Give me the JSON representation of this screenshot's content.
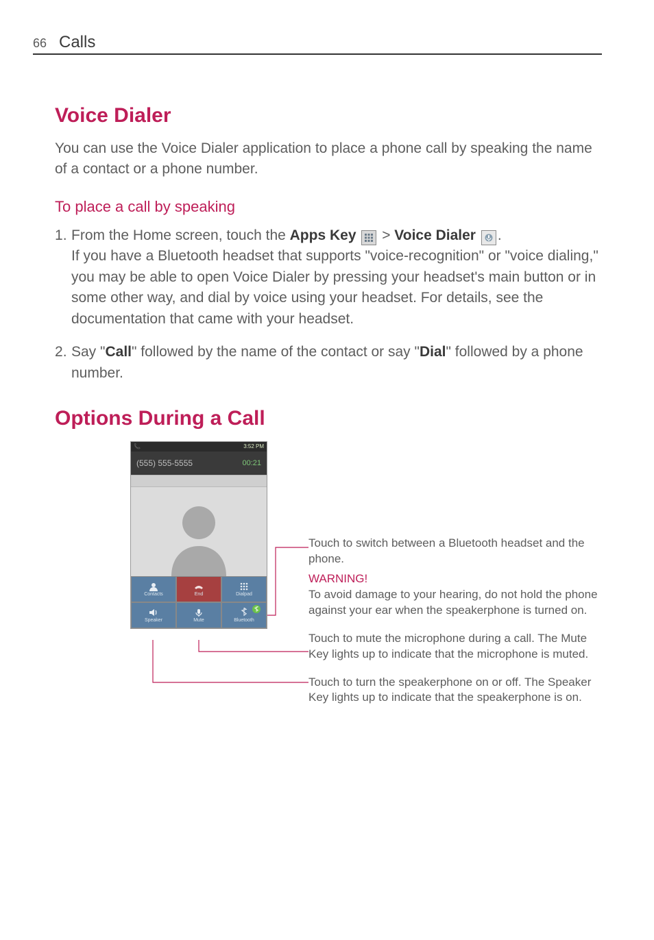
{
  "page": {
    "number": "66",
    "section": "Calls"
  },
  "voiceDialer": {
    "heading": "Voice Dialer",
    "intro": "You can use the Voice Dialer application to place a phone call by speaking the name of a contact or a phone number.",
    "subheading": "To place a call by speaking",
    "step1": {
      "pre": "From the Home screen, touch the ",
      "appsKey": "Apps Key",
      "mid": " > ",
      "voiceDialer": "Voice Dialer",
      "post": ".",
      "rest": "If you have a Bluetooth headset that supports \"voice-recognition\" or \"voice dialing,\" you may be able to open Voice Dialer by pressing your headset's main button or in some other way, and dial by voice using your headset. For details, see the documentation that came with your headset."
    },
    "step2": {
      "pre": "Say \"",
      "call": "Call",
      "mid": "\" followed by the name of the contact or say \"",
      "dial": "Dial",
      "post": "\" followed by a phone number."
    }
  },
  "optionsDuringCall": {
    "heading": "Options During a Call",
    "screenshot": {
      "statusTime": "3:52 PM",
      "phoneNumber": "(555) 555-5555",
      "duration": "00:21",
      "buttons": {
        "contacts": "Contacts",
        "end": "End",
        "dialpad": "Dialpad",
        "speaker": "Speaker",
        "mute": "Mute",
        "bluetooth": "Bluetooth"
      }
    },
    "callouts": {
      "bluetooth": "Touch to switch between a Bluetooth headset and the phone.",
      "warningLabel": "WARNING!",
      "warningText": "To avoid damage to your hearing, do not hold the phone against your ear when the speakerphone is turned on.",
      "mute": "Touch to mute the microphone during a call. The Mute Key lights up to indicate that the microphone is muted.",
      "speaker": "Touch to turn the speakerphone on or off. The Speaker Key lights up to indicate that the speakerphone is on."
    }
  }
}
